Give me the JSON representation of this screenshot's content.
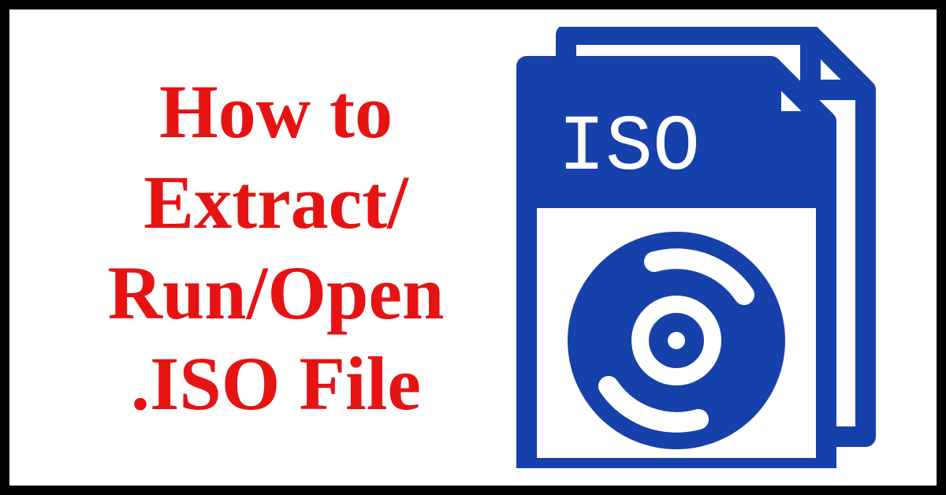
{
  "title": {
    "line1": "How to",
    "line2": "Extract/",
    "line3": "Run/Open",
    "line4": ".ISO File"
  },
  "icon": {
    "label": "ISO",
    "color": "#1741aa"
  }
}
